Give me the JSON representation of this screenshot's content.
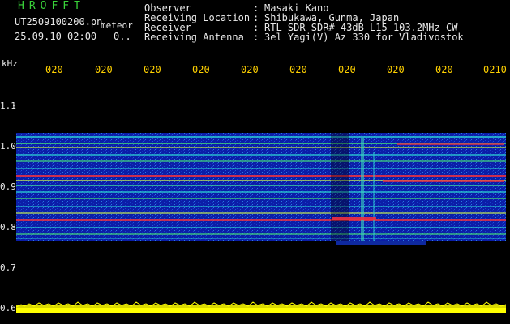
{
  "header": {
    "logo": "HROFFT",
    "filename": "UT2509100200.pn",
    "tag": "meteor",
    "datetime": "25.09.10 02:00",
    "counter": "0.."
  },
  "info": {
    "rows": [
      {
        "key": "Observer",
        "colon": ":",
        "value": "Masaki Kano"
      },
      {
        "key": "Receiving Location",
        "colon": ":",
        "value": "Shibukawa, Gunma, Japan"
      },
      {
        "key": "Receiver",
        "colon": ":",
        "value": "RTL-SDR SDR# 43dB L15 103.2MHz CW"
      },
      {
        "key": "Receiving Antenna",
        "colon": ":",
        "value": "3el Yagi(V) Az 330 for Vladivostok"
      }
    ]
  },
  "axis": {
    "unit": "kHz",
    "y_ticks": [
      "1.1",
      "1.0",
      "0.9",
      "0.8",
      "0.7",
      "0.6"
    ],
    "x_ticks": [
      "020",
      "020",
      "020",
      "020",
      "020",
      "020",
      "020",
      "020",
      "020",
      "0210"
    ]
  },
  "colors": {
    "background": "#000000",
    "text": "#e9e9e9",
    "logo": "#39d43a",
    "axis_ticks": "#ffd100",
    "noise_floor": "#ffff00",
    "waterfall_bg": "#0a1aa0"
  }
}
